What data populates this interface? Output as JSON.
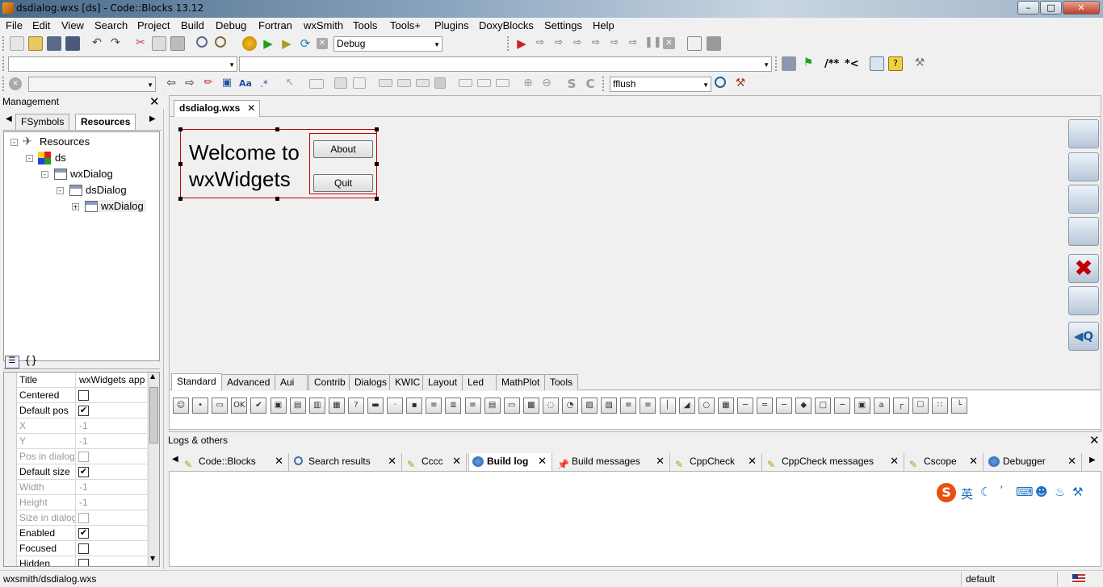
{
  "window": {
    "title": "dsdialog.wxs [ds] - Code::Blocks 13.12"
  },
  "menu": [
    "File",
    "Edit",
    "View",
    "Search",
    "Project",
    "Build",
    "Debug",
    "Fortran",
    "wxSmith",
    "Tools",
    "Tools+",
    "Plugins",
    "DoxyBlocks",
    "Settings",
    "Help"
  ],
  "toolbar": {
    "build_target": "Debug",
    "search_combo": "fflush",
    "doxy_block": "/**",
    "doxy_line": "*<"
  },
  "management": {
    "title": "Management",
    "tabs": [
      "FSymbols",
      "Resources"
    ],
    "tree": [
      "Resources",
      "ds",
      "wxDialog",
      "dsDialog",
      "wxDialog"
    ],
    "bottom_tab_icon": "{}"
  },
  "properties": [
    {
      "name": "Title",
      "value": "wxWidgets app",
      "type": "text",
      "enabled": true
    },
    {
      "name": "Centered",
      "checked": false,
      "type": "check",
      "enabled": true
    },
    {
      "name": "Default pos",
      "checked": true,
      "type": "check",
      "enabled": true
    },
    {
      "name": "X",
      "value": "-1",
      "type": "text",
      "enabled": false
    },
    {
      "name": "Y",
      "value": "-1",
      "type": "text",
      "enabled": false
    },
    {
      "name": "Pos in dialog units",
      "checked": false,
      "type": "check",
      "enabled": false
    },
    {
      "name": "Default size",
      "checked": true,
      "type": "check",
      "enabled": true
    },
    {
      "name": "Width",
      "value": "-1",
      "type": "text",
      "enabled": false
    },
    {
      "name": "Height",
      "value": "-1",
      "type": "text",
      "enabled": false
    },
    {
      "name": "Size in dialog units",
      "checked": false,
      "type": "check",
      "enabled": false
    },
    {
      "name": "Enabled",
      "checked": true,
      "type": "check",
      "enabled": true
    },
    {
      "name": "Focused",
      "checked": false,
      "type": "check",
      "enabled": true
    },
    {
      "name": "Hidden",
      "checked": false,
      "type": "check",
      "enabled": true
    }
  ],
  "editor": {
    "tab": "dsdialog.wxs",
    "preview": {
      "text_line1": "Welcome to",
      "text_line2": "wxWidgets",
      "about": "About",
      "quit": "Quit"
    },
    "palette_tabs": [
      "Standard",
      "Advanced",
      "Aui",
      "Contrib",
      "Dialogs",
      "KWIC",
      "Layout",
      "Led",
      "MathPlot",
      "Tools"
    ],
    "palette_count": 41
  },
  "logs": {
    "title": "Logs & others",
    "tabs": [
      "Code::Blocks",
      "Search results",
      "Cccc",
      "Build log",
      "Build messages",
      "CppCheck",
      "CppCheck messages",
      "Cscope",
      "Debugger"
    ],
    "active": "Build log",
    "ime": "英"
  },
  "status": {
    "path": "wxsmith/dsdialog.wxs",
    "mode": "default"
  },
  "colors": {
    "selection_red": "#c00000",
    "accent_blue": "#2060c0"
  }
}
